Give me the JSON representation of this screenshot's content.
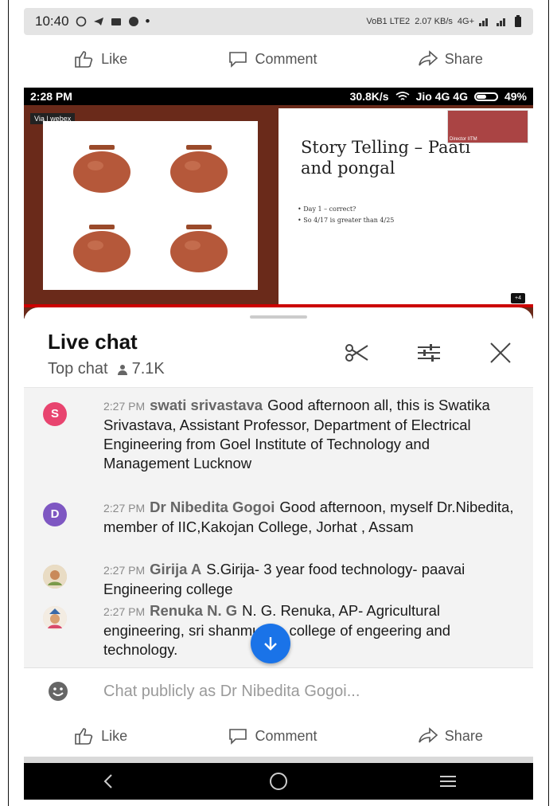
{
  "status_bar": {
    "time": "10:40",
    "network": "2.07 KB/s",
    "signal": "4G+"
  },
  "action_bar": {
    "like": "Like",
    "comment": "Comment",
    "share": "Share"
  },
  "video": {
    "status_time": "2:28 PM",
    "speed": "30.8K/s",
    "carrier": "Jio 4G 4G",
    "battery": "49%",
    "webex_label": "Via | webex",
    "slide_title_line1": "Story Telling – Paati",
    "slide_title_line2": "and pongal",
    "bullet1": "•  Day 1 – correct?",
    "bullet2": "•  So 4/17 is greater than 4/25",
    "director_label": "Director IITM",
    "pip_label": "+4"
  },
  "chat": {
    "title": "Live chat",
    "mode": "Top chat",
    "viewers": "7.1K",
    "input_placeholder": "Chat publicly as Dr Nibedita Gogoi...",
    "messages": [
      {
        "initial": "S",
        "color": "#e8446f",
        "time": "2:27 PM",
        "author": "swati srivastava",
        "text": "Good afternoon all, this is Swatika Srivastava, Assistant Professor, Department of Electrical Engineering from Goel Institute of Technology and Management Lucknow"
      },
      {
        "initial": "D",
        "color": "#7e57c2",
        "time": "2:27 PM",
        "author": "Dr Nibedita Gogoi",
        "text": "Good afternoon, myself Dr.Nibedita, member of IIC,Kakojan College, Jorhat , Assam"
      },
      {
        "initial": "",
        "color": "#d8c2a0",
        "time": "2:27 PM",
        "author": "Girija A",
        "text": "S.Girija- 3 year food technology- paavai Engineering college"
      },
      {
        "initial": "",
        "color": "#e8d8c8",
        "time": "2:27 PM",
        "author": "Renuka N. G",
        "text": "N. G. Renuka, AP- Agricultural engineering, sri shanmugha college of engeering and technology."
      }
    ]
  },
  "bottom_action_bar": {
    "like": "Like",
    "comment": "Comment",
    "share": "Share"
  }
}
